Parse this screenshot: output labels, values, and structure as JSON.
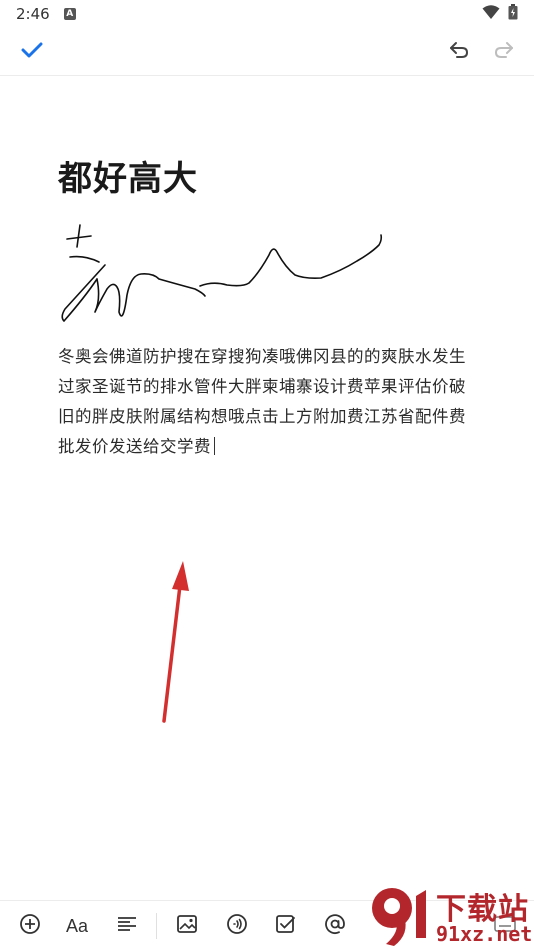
{
  "status_bar": {
    "time": "2:46",
    "badge": "A"
  },
  "icons": {
    "confirm": "check-icon",
    "undo": "undo-icon",
    "redo": "redo-icon",
    "add": "add-circle-icon",
    "format": "text-format-icon",
    "align": "align-left-icon",
    "image": "image-icon",
    "audio": "audio-icon",
    "checklist": "checkbox-icon",
    "mention": "at-icon",
    "keyboard": "keyboard-icon"
  },
  "note": {
    "title": "都好高大",
    "body": "冬奥会佛道防护搜在穿搜狗凑哦佛冈县的的爽肤水发生过家圣诞节的排水管件大胖柬埔寨设计费苹果评估价破旧的胖皮肤附属结构想哦点击上方附加费江苏省配件费批发价发送给交学费"
  },
  "toolbar": {
    "format_label": "Aa"
  },
  "watermark": {
    "brand": "下载站",
    "domain": "91xz.net"
  },
  "colors": {
    "accent": "#1a73e8",
    "annotation_arrow": "#d32f2f",
    "watermark": "#b3262b"
  }
}
